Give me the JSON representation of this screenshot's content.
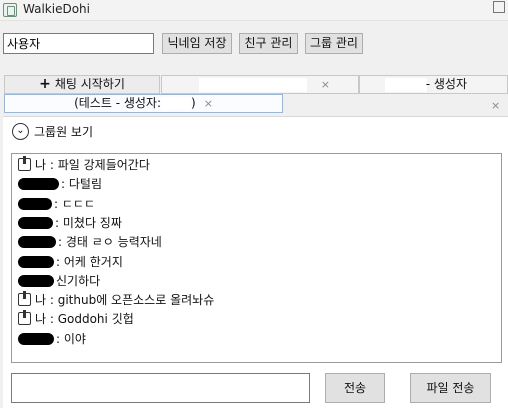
{
  "window": {
    "title": "WalkieDohi",
    "icon": "walkie-talkie-icon"
  },
  "toolbar": {
    "nickname_value": "사용자",
    "save_nickname_label": "닉네임 저장",
    "friends_label": "친구 관리",
    "groups_label": "그룹 관리"
  },
  "tabs": {
    "start_chat": {
      "icon": "+",
      "label": "채팅 시작하기"
    },
    "tab_b": {
      "close": "×"
    },
    "tab_c": {
      "suffix": "- 생성자"
    },
    "active": {
      "label_start": "(테스트 - 생성자:",
      "label_end": ")",
      "close": "×"
    },
    "extra_close": "×"
  },
  "group_toggle": {
    "icon": "chevron-down-icon",
    "glyph": "⌄",
    "label": "그룹원 보기"
  },
  "messages": [
    {
      "own": true,
      "sender": "나",
      "sep": " : ",
      "text": "파일 강제들어간다"
    },
    {
      "own": false,
      "sep": ": ",
      "text": "다털림"
    },
    {
      "own": false,
      "sep": ": ",
      "text": "ㄷㄷㄷ"
    },
    {
      "own": false,
      "sep": ": ",
      "text": "미쳤다 징짜"
    },
    {
      "own": false,
      "sep": ": ",
      "text": "경태 ㄹㅇ 능력자네"
    },
    {
      "own": false,
      "sep": ": ",
      "text": "어케 한거지"
    },
    {
      "own": false,
      "sep": "",
      "text": "신기하다"
    },
    {
      "own": true,
      "sender": "나",
      "sep": " : ",
      "text": "github에 오픈소스로 올려놔슈"
    },
    {
      "own": true,
      "sender": "나",
      "sep": " : ",
      "text": "Goddohi 깃헙"
    },
    {
      "own": false,
      "sep": ": ",
      "text": "이야"
    }
  ],
  "bottom": {
    "message_value": "",
    "send_label": "전송",
    "file_send_label": "파일 전송"
  }
}
